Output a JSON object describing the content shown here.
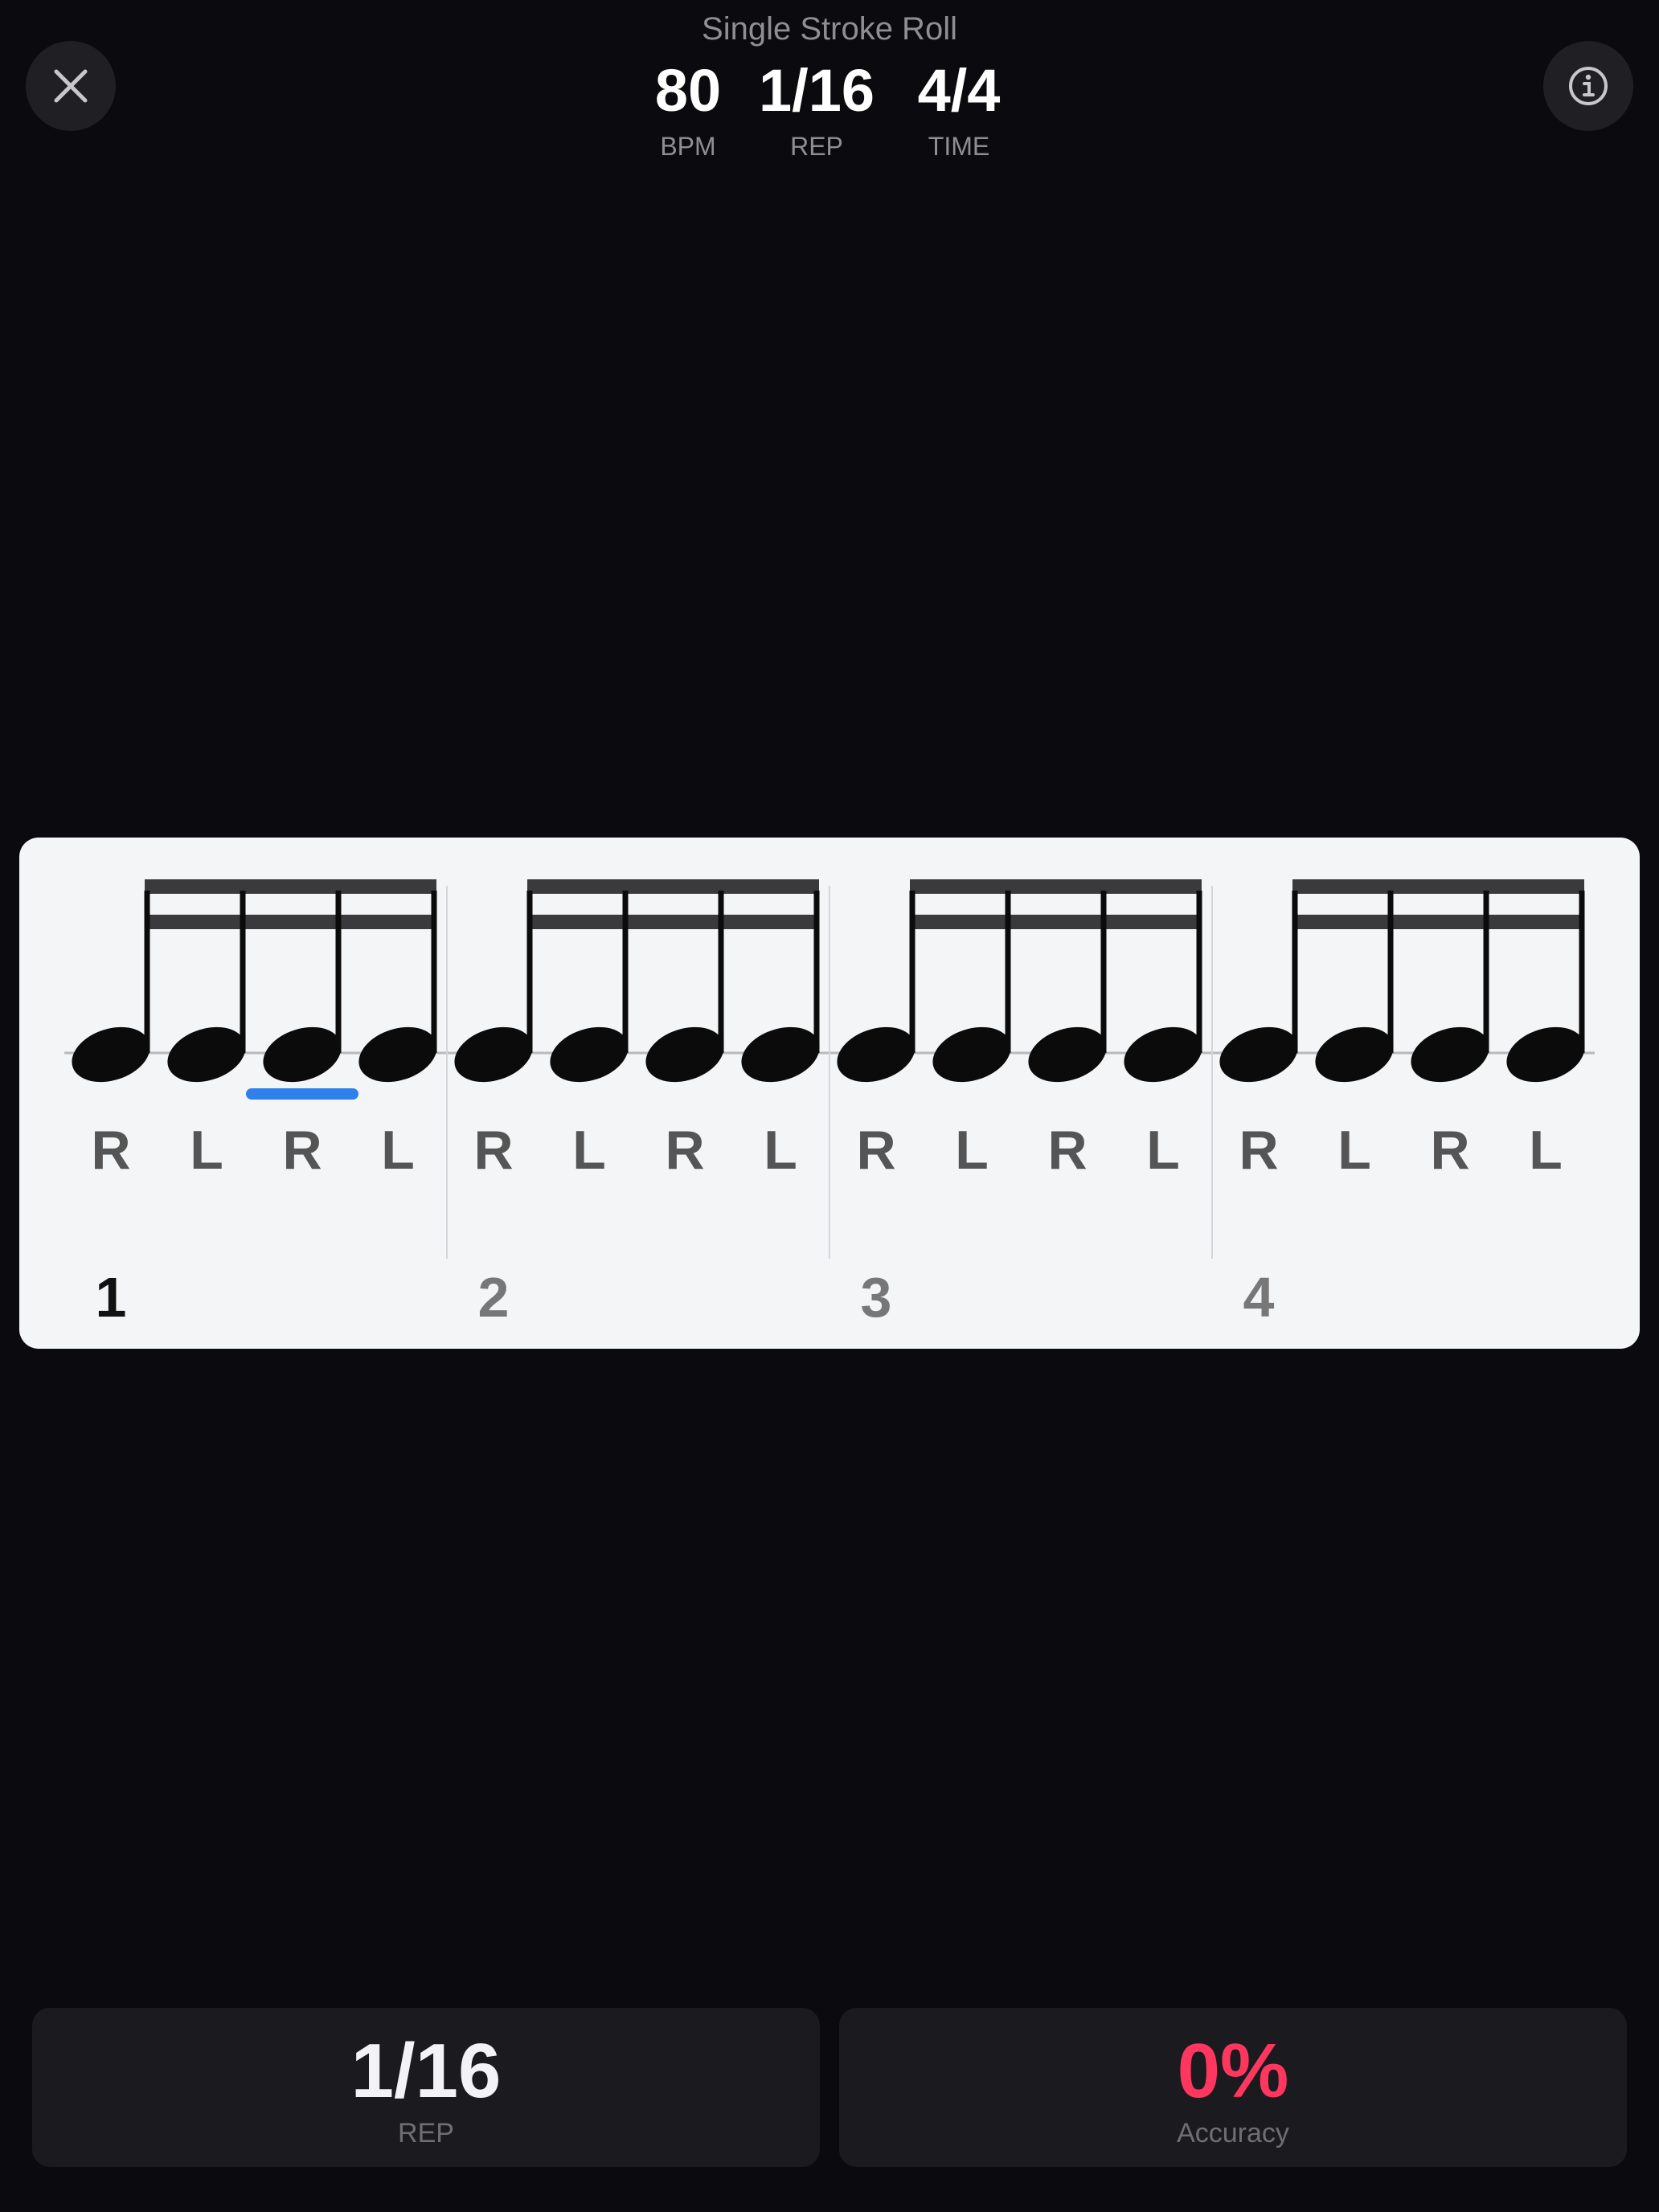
{
  "header": {
    "title": "Single Stroke Roll",
    "bpm_value": "80",
    "bpm_label": "BPM",
    "rep_value": "1/16",
    "rep_label": "REP",
    "time_value": "4/4",
    "time_label": "TIME"
  },
  "icons": {
    "close": "close-icon",
    "info": "info-icon"
  },
  "notation": {
    "beats": [
      {
        "label": "1",
        "sticking": [
          "R",
          "L",
          "R",
          "L"
        ],
        "active": true
      },
      {
        "label": "2",
        "sticking": [
          "R",
          "L",
          "R",
          "L"
        ],
        "active": false
      },
      {
        "label": "3",
        "sticking": [
          "R",
          "L",
          "R",
          "L"
        ],
        "active": false
      },
      {
        "label": "4",
        "sticking": [
          "R",
          "L",
          "R",
          "L"
        ],
        "active": false
      }
    ],
    "current_note": {
      "beat": 1,
      "note": 3
    },
    "colors": {
      "cursor": "#2f80ed",
      "note": "#0b0b0b",
      "beam": "#3a3a3c",
      "sticking": "#555555",
      "beat_active": "#111111",
      "beat_inactive": "#777777"
    }
  },
  "footer": {
    "rep_value": "1/16",
    "rep_label": "REP",
    "accuracy_value": "0%",
    "accuracy_label": "Accuracy",
    "accuracy_color": "#ff375f"
  }
}
